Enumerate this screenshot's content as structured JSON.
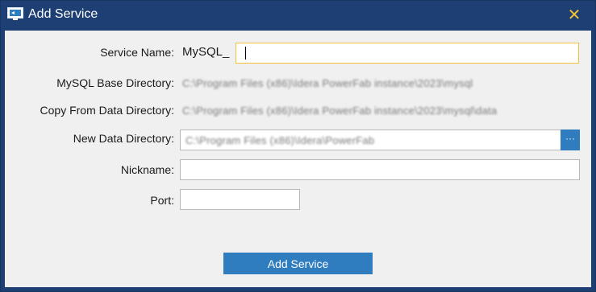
{
  "window": {
    "title": "Add Service",
    "close_glyph": "✕",
    "accent_color": "#1e3f74",
    "button_color": "#2f7cbf",
    "focus_color": "#f2c23a"
  },
  "form": {
    "service_name": {
      "label": "Service Name:",
      "prefix": "MySQL_",
      "value": ""
    },
    "base_directory": {
      "label": "MySQL Base Directory:",
      "value": "C:\\Program Files (x86)\\Idera PowerFab instance\\2023\\mysql"
    },
    "copy_from_directory": {
      "label": "Copy From Data Directory:",
      "value": "C:\\Program Files (x86)\\Idera PowerFab instance\\2023\\mysql\\data"
    },
    "new_data_directory": {
      "label": "New Data Directory:",
      "value": "C:\\Program Files (x86)\\Idera\\PowerFab",
      "browse_label": "···"
    },
    "nickname": {
      "label": "Nickname:",
      "value": ""
    },
    "port": {
      "label": "Port:",
      "value": ""
    }
  },
  "actions": {
    "submit_label": "Add Service"
  }
}
